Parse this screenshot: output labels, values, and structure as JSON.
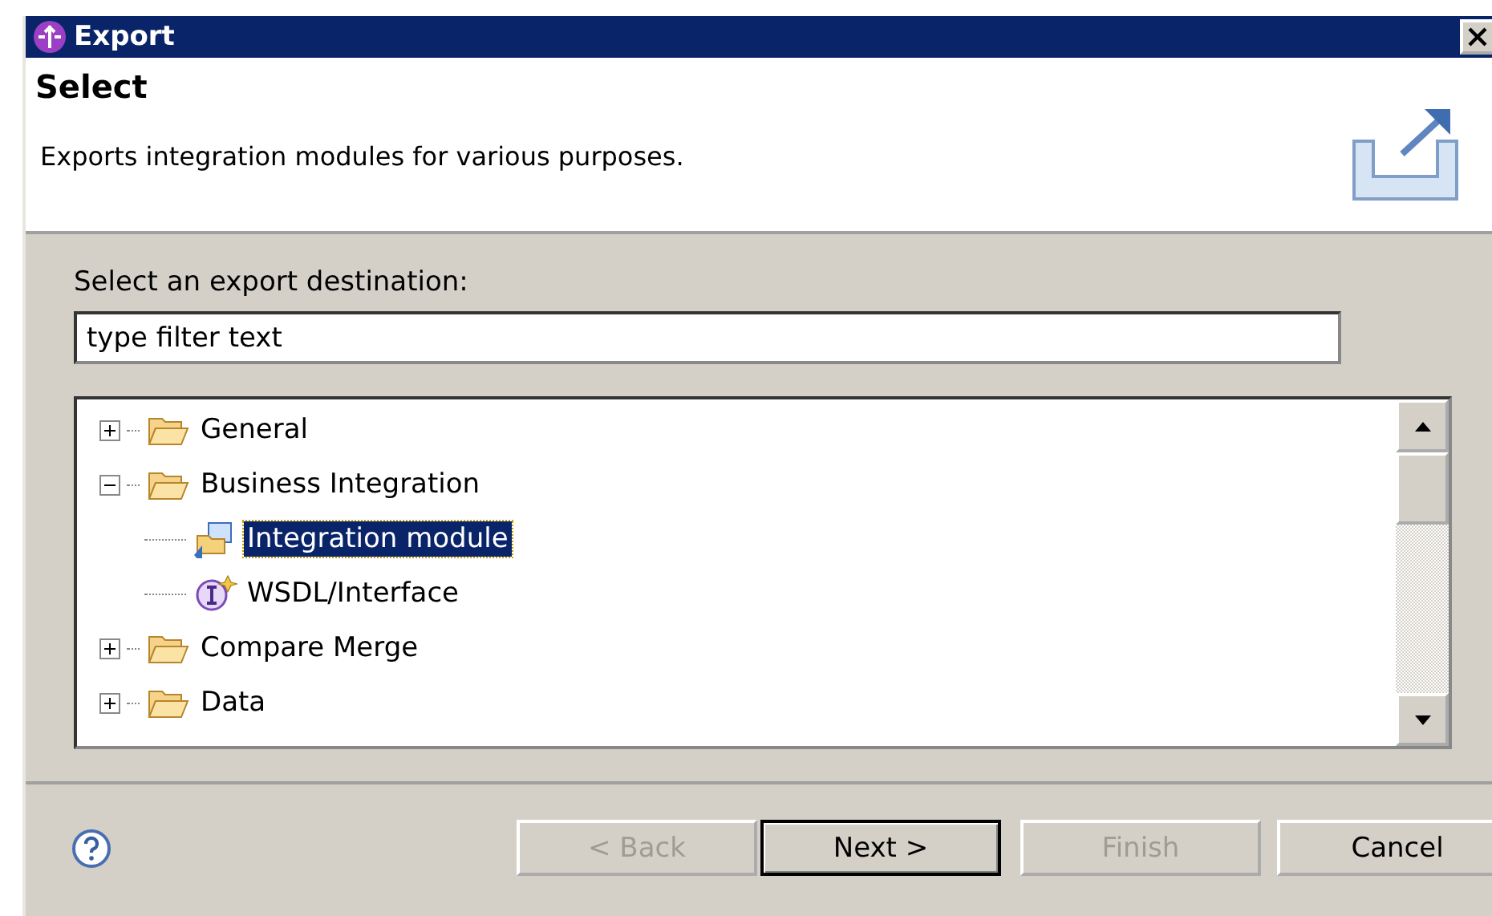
{
  "window": {
    "title": "Export"
  },
  "header": {
    "title": "Select",
    "description": "Exports integration modules for various purposes."
  },
  "filter": {
    "label": "Select an export destination:",
    "value": "type filter text"
  },
  "tree": [
    {
      "label": "General",
      "kind": "folder",
      "expanded": false,
      "selected": false
    },
    {
      "label": "Business Integration",
      "kind": "folder",
      "expanded": true,
      "selected": false,
      "children": [
        {
          "label": "Integration module",
          "kind": "module",
          "selected": true
        },
        {
          "label": "WSDL/Interface",
          "kind": "interface",
          "selected": false
        }
      ]
    },
    {
      "label": "Compare Merge",
      "kind": "folder",
      "expanded": false,
      "selected": false
    },
    {
      "label": "Data",
      "kind": "folder",
      "expanded": false,
      "selected": false
    }
  ],
  "buttons": [
    {
      "label": "< Back",
      "disabled": true,
      "default": false
    },
    {
      "label": "Next >",
      "disabled": false,
      "default": true
    },
    {
      "label": "Finish",
      "disabled": true,
      "default": false
    },
    {
      "label": "Cancel",
      "disabled": false,
      "default": false
    }
  ]
}
